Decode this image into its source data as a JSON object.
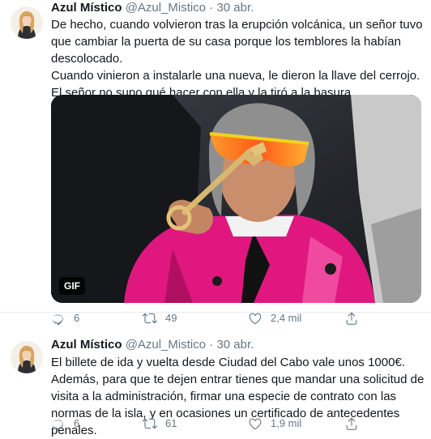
{
  "tweets": [
    {
      "author_name": "Azul Místico",
      "handle": "@Azul_Mistico",
      "separator": "·",
      "date": "30 abr.",
      "paragraph1": "De hecho, cuando volvieron tras la erupción volcánica, un señor tuvo que cambiar la puerta de su casa porque los temblores la habían descolocado.",
      "paragraph2": "Cuando vinieron a instalarle una nueva, le dieron la llave del cerrojo. El señor no supo qué hacer con ella y la tiró a la basura.",
      "media_badge": "GIF",
      "replies": "6",
      "retweets": "49",
      "likes": "2,4 mil"
    },
    {
      "author_name": "Azul Místico",
      "handle": "@Azul_Mistico",
      "separator": "·",
      "date": "30 abr.",
      "paragraph1": "El billete de ida y vuelta desde Ciudad del Cabo vale unos 1000€.",
      "paragraph2": "Además, para que te dejen entrar tienes que mandar una solicitud de visita a la administración, firmar una especie de contrato con las normas de la isla, y en ocasiones un certificado de antecedentes penales.",
      "replies": "6",
      "retweets": "61",
      "likes": "1,9 mil"
    }
  ],
  "icons": {
    "reply": "reply-icon",
    "retweet": "retweet-icon",
    "like": "heart-icon",
    "share": "share-icon"
  },
  "colors": {
    "text": "#14171a",
    "secondary": "#657786",
    "divider": "#e6ecf0",
    "jacket_pink": "#e0177e",
    "sunglasses": "#ff7a1a"
  }
}
